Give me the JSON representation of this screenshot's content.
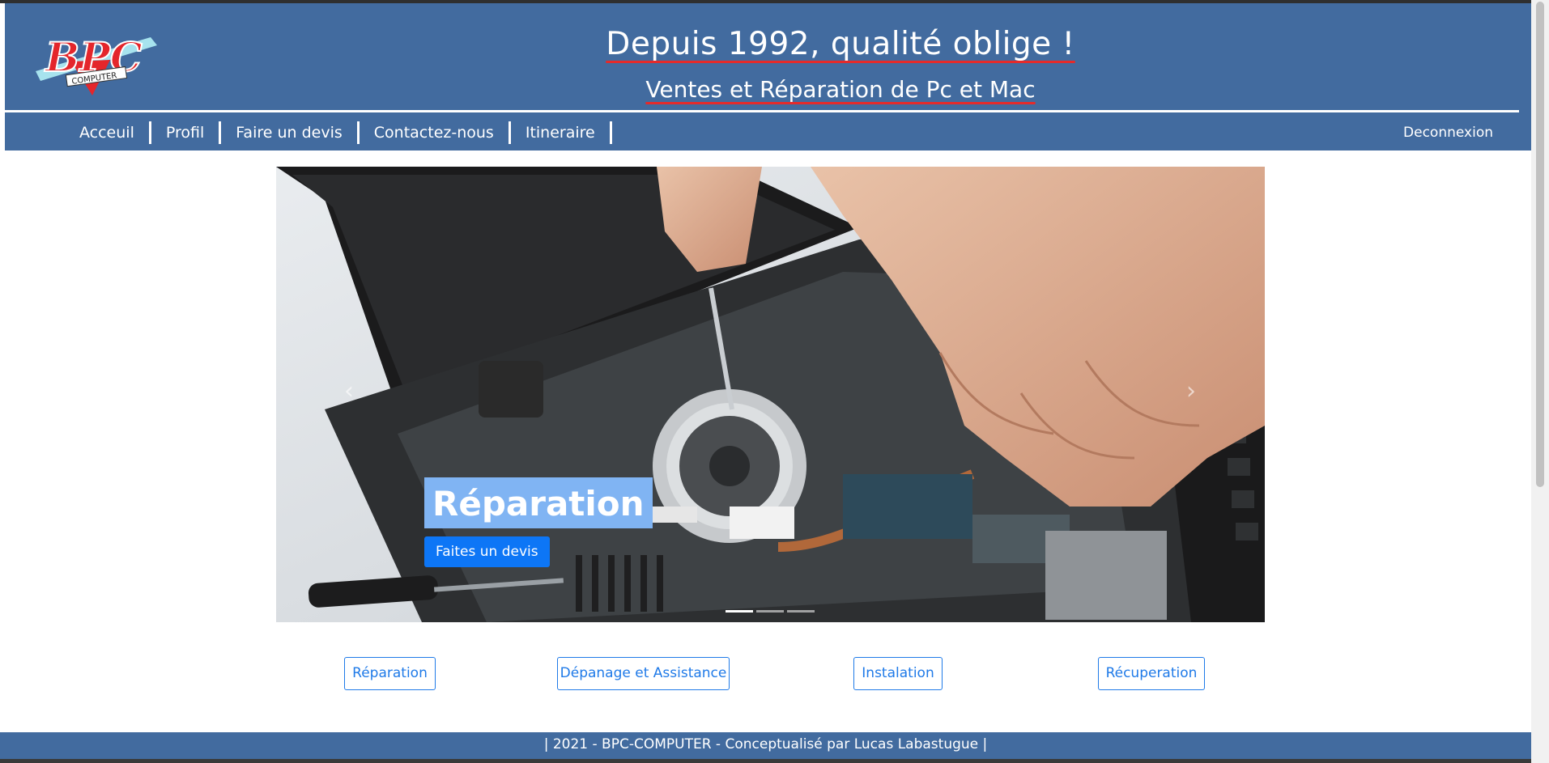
{
  "header": {
    "title": "Depuis 1992, qualité oblige !",
    "subtitle": "Ventes et Réparation de Pc et Mac",
    "logo_text": "BPC",
    "logo_subtext": "COMPUTER",
    "colors": {
      "background": "#426b9f",
      "underline": "#e52a2a"
    }
  },
  "nav": {
    "items": [
      {
        "label": "Acceuil"
      },
      {
        "label": "Profil"
      },
      {
        "label": "Faire un devis"
      },
      {
        "label": "Contactez-nous"
      },
      {
        "label": "Itineraire"
      }
    ],
    "logout_label": "Deconnexion"
  },
  "carousel": {
    "caption_title": "Réparation",
    "caption_button": "Faites un devis",
    "prev_icon": "chevron-left-icon",
    "next_icon": "chevron-right-icon",
    "prev_glyph": "‹",
    "next_glyph": "›",
    "slide_count": 3,
    "active_index": 0
  },
  "services": [
    {
      "label": "Réparation"
    },
    {
      "label": "Dépanage et Assistance"
    },
    {
      "label": "Instalation"
    },
    {
      "label": "Récuperation"
    }
  ],
  "footer": {
    "text": "| 2021 - BPC-COMPUTER - Conceptualisé par Lucas Labastugue |"
  }
}
